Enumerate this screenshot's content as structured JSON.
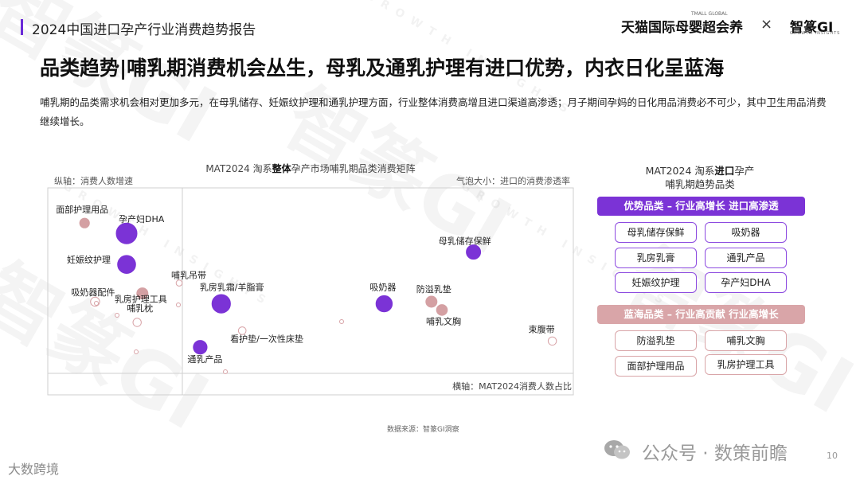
{
  "header": {
    "report_title": "2024中国进口孕产行业消费趋势报告",
    "brand_tmall": "天猫国际母婴超会养",
    "brand_tmall_en": "TMALL GLOBAL",
    "separator": "×",
    "brand_zz": "智篆GI",
    "brand_zz_en": "GROWTH INSIGHTS"
  },
  "headline": "品类趋势|哺乳期消费机会丛生，母乳及通乳护理有进口优势，内衣日化呈蓝海",
  "description": "哺乳期的品类需求机会相对更加多元，在母乳储存、妊娠纹护理和通乳护理方面，行业整体消费高增且进口渠道高渗透；月子期间孕妈的日化用品消费必不可少，其中卫生用品消费继续增长。",
  "chart": {
    "title_prefix": "MAT2024 淘系",
    "title_bold": "整体",
    "title_suffix": "孕产市场哺乳期品类消费矩阵",
    "y_axis_note": "纵轴：消费人数增速",
    "bubble_note": "气泡大小：进口的消费渗透率",
    "x_axis_note": "横轴：MAT2024消费人数占比",
    "source": "数据来源：智篆GI洞察"
  },
  "chart_data": {
    "type": "scatter",
    "title": "MAT2024 淘系整体孕产市场哺乳期品类消费矩阵",
    "xlabel": "横轴：MAT2024消费人数占比",
    "ylabel": "纵轴：消费人数增速",
    "size_label": "气泡大小：进口的消费渗透率",
    "axis_scale": "relative (0–100 estimated, no ticks shown)",
    "xlim": [
      0,
      100
    ],
    "ylim": [
      0,
      100
    ],
    "colors": {
      "advantage": "#7b33d6",
      "blue_ocean": "#d4a0a3"
    },
    "points": [
      {
        "label": "面部护理用品",
        "x": 7,
        "y": 83,
        "size": 2.2,
        "group": "blue_ocean"
      },
      {
        "label": "孕产妇DHA",
        "x": 15,
        "y": 78,
        "size": 5.2,
        "group": "advantage"
      },
      {
        "label": "妊娠纹护理",
        "x": 15,
        "y": 63,
        "size": 4.5,
        "group": "advantage"
      },
      {
        "label": "吸奶器配件",
        "x": 9,
        "y": 45,
        "size": 1.6,
        "group": "other"
      },
      {
        "label": "乳房护理工具",
        "x": 18,
        "y": 49,
        "size": 2.6,
        "group": "blue_ocean"
      },
      {
        "label": "哺乳枕",
        "x": 17,
        "y": 35,
        "size": 1.4,
        "group": "other"
      },
      {
        "label": "哺乳吊带",
        "x": 25,
        "y": 54,
        "size": 0.8,
        "group": "other"
      },
      {
        "label": "乳房乳霜/羊脂膏",
        "x": 33,
        "y": 44,
        "size": 4.6,
        "group": "advantage"
      },
      {
        "label": "通乳产品",
        "x": 29,
        "y": 23,
        "size": 3.3,
        "group": "advantage"
      },
      {
        "label": "看护垫/一次性床垫",
        "x": 37,
        "y": 31,
        "size": 1.2,
        "group": "other"
      },
      {
        "label": "吸奶器",
        "x": 64,
        "y": 44,
        "size": 4.0,
        "group": "advantage"
      },
      {
        "label": "防溢乳垫",
        "x": 73,
        "y": 45,
        "size": 2.6,
        "group": "blue_ocean"
      },
      {
        "label": "哺乳文胸",
        "x": 75,
        "y": 41,
        "size": 2.5,
        "group": "blue_ocean"
      },
      {
        "label": "母乳储存保鲜",
        "x": 81,
        "y": 69,
        "size": 3.5,
        "group": "advantage"
      },
      {
        "label": "束腹带",
        "x": 96,
        "y": 26,
        "size": 1.4,
        "group": "other"
      }
    ]
  },
  "side": {
    "title_line1_prefix": "MAT2024 淘系",
    "title_line1_bold": "进口",
    "title_line1_suffix": "孕产",
    "title_line2": "哺乳期趋势品类",
    "advantage_label": "优势品类 – 行业高增长 进口高渗透",
    "advantage_items": [
      "母乳储存保鲜",
      "吸奶器",
      "乳房乳膏",
      "通乳产品",
      "妊娠纹护理",
      "孕产妇DHA"
    ],
    "blue_label": "蓝海品类 – 行业高贡献 行业高增长",
    "blue_items": [
      "防溢乳垫",
      "哺乳文胸",
      "面部护理用品",
      "乳房护理工具"
    ]
  },
  "footer": {
    "wechat_text": "公众号 · 数策前瞻",
    "page_number": "10",
    "corner_logo": "大数跨境"
  },
  "watermark": {
    "text": "智篆GI",
    "sub": "GROWTH INSIGHTS"
  }
}
